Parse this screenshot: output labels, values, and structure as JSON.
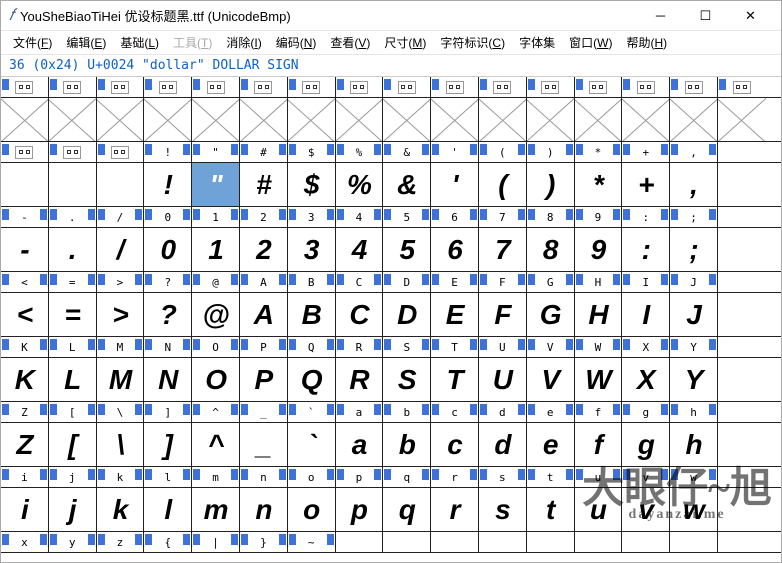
{
  "window": {
    "title": "YouSheBiaoTiHei 优设标题黑.ttf (UnicodeBmp)",
    "min": "─",
    "max": "☐",
    "close": "✕"
  },
  "menu": [
    {
      "label": "文件",
      "u": "F"
    },
    {
      "label": "编辑",
      "u": "E"
    },
    {
      "label": "基础",
      "u": "L"
    },
    {
      "label": "工具",
      "u": "T",
      "disabled": true
    },
    {
      "label": "消除",
      "u": "I"
    },
    {
      "label": "编码",
      "u": "N"
    },
    {
      "label": "查看",
      "u": "V"
    },
    {
      "label": "尺寸",
      "u": "M"
    },
    {
      "label": "字符标识",
      "u": "C"
    },
    {
      "label": "字体集"
    },
    {
      "label": "窗口",
      "u": "W"
    },
    {
      "label": "帮助",
      "u": "H"
    }
  ],
  "status": "36 (0x24) U+0024 \"dollar\" DOLLAR SIGN",
  "chart_data": {
    "type": "table",
    "columns": 16,
    "selected": {
      "row": 1,
      "col": 4,
      "char": "$"
    },
    "rows": [
      {
        "labels": [
          "",
          "",
          "",
          "",
          "",
          "",
          "",
          "",
          "",
          "",
          "",
          "",
          "",
          "",
          "",
          ""
        ],
        "glyphs": [
          "x",
          "x",
          "x",
          "x",
          "x",
          "x",
          "x",
          "x",
          "x",
          "x",
          "x",
          "x",
          "x",
          "x",
          "x",
          "x"
        ],
        "boxed": true
      },
      {
        "labels": [
          "",
          "",
          "",
          "!",
          "\"",
          "#",
          "$",
          "%",
          "&",
          "'",
          "(",
          ")",
          "*",
          "+",
          ","
        ],
        "glyphs": [
          "",
          "",
          "",
          "!",
          "\"",
          "#",
          "$",
          "%",
          "&",
          "'",
          "(",
          ")",
          "*",
          "+",
          ","
        ],
        "boxed": true,
        "boxcount": 3
      },
      {
        "labels": [
          "-",
          ".",
          "/",
          "0",
          "1",
          "2",
          "3",
          "4",
          "5",
          "6",
          "7",
          "8",
          "9",
          ":",
          ";"
        ],
        "glyphs": [
          "-",
          ".",
          "/",
          "0",
          "1",
          "2",
          "3",
          "4",
          "5",
          "6",
          "7",
          "8",
          "9",
          ":",
          ";"
        ]
      },
      {
        "labels": [
          "<",
          "=",
          ">",
          "?",
          "@",
          "A",
          "B",
          "C",
          "D",
          "E",
          "F",
          "G",
          "H",
          "I",
          "J"
        ],
        "glyphs": [
          "<",
          "=",
          ">",
          "?",
          "@",
          "A",
          "B",
          "C",
          "D",
          "E",
          "F",
          "G",
          "H",
          "I",
          "J"
        ]
      },
      {
        "labels": [
          "K",
          "L",
          "M",
          "N",
          "O",
          "P",
          "Q",
          "R",
          "S",
          "T",
          "U",
          "V",
          "W",
          "X",
          "Y"
        ],
        "glyphs": [
          "K",
          "L",
          "M",
          "N",
          "O",
          "P",
          "Q",
          "R",
          "S",
          "T",
          "U",
          "V",
          "W",
          "X",
          "Y"
        ]
      },
      {
        "labels": [
          "Z",
          "[",
          "\\",
          "]",
          "^",
          "_",
          "`",
          "a",
          "b",
          "c",
          "d",
          "e",
          "f",
          "g",
          "h"
        ],
        "glyphs": [
          "Z",
          "[",
          "\\",
          "]",
          "^",
          "_",
          "`",
          "a",
          "b",
          "c",
          "d",
          "e",
          "f",
          "g",
          "h"
        ]
      },
      {
        "labels": [
          "i",
          "j",
          "k",
          "l",
          "m",
          "n",
          "o",
          "p",
          "q",
          "r",
          "s",
          "t",
          "u",
          "v",
          "w"
        ],
        "glyphs": [
          "i",
          "j",
          "k",
          "l",
          "m",
          "n",
          "o",
          "p",
          "q",
          "r",
          "s",
          "t",
          "u",
          "v",
          "w"
        ]
      },
      {
        "labels": [
          "x",
          "y",
          "z",
          "{",
          "|",
          "}",
          "~",
          "",
          "",
          "",
          "",
          "",
          "",
          "",
          ""
        ],
        "glyphs": []
      }
    ]
  },
  "watermark": {
    "main": "大眼仔~旭",
    "sub": "dayanzai.me"
  }
}
